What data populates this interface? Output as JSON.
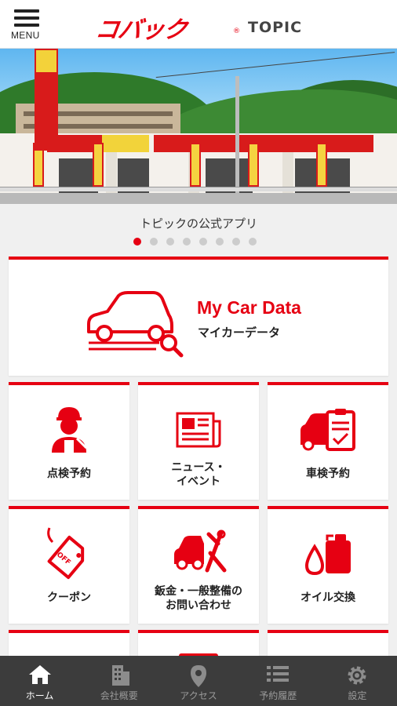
{
  "header": {
    "menu_label": "MENU",
    "logo_text": "コバック",
    "logo_mark": "®",
    "topic_label": "TOPIC"
  },
  "banner": {
    "caption": "トピックの公式アプリ",
    "slide_count": 8,
    "active_slide": 1
  },
  "main": {
    "mycar": {
      "title": "My Car Data",
      "subtitle": "マイカーデータ",
      "icon": "car-search-icon"
    },
    "tiles": [
      {
        "label": "点検予約",
        "icon": "mechanic-icon"
      },
      {
        "label_line1": "ニュース・",
        "label_line2": "イベント",
        "icon": "newspaper-icon"
      },
      {
        "label": "車検予約",
        "icon": "car-checklist-icon"
      },
      {
        "label": "クーポン",
        "icon": "coupon-tag-icon",
        "tag_text": "OFF"
      },
      {
        "label_line1": "鈑金・一般整備の",
        "label_line2": "お問い合わせ",
        "icon": "car-repair-tools-icon"
      },
      {
        "label": "オイル交換",
        "icon": "oil-can-icon"
      }
    ]
  },
  "bottom_nav": {
    "items": [
      {
        "label": "ホーム",
        "icon": "home-icon",
        "active": true
      },
      {
        "label": "会社概要",
        "icon": "building-icon",
        "active": false
      },
      {
        "label": "アクセス",
        "icon": "map-pin-icon",
        "active": false
      },
      {
        "label": "予約履歴",
        "icon": "list-icon",
        "active": false
      },
      {
        "label": "設定",
        "icon": "gear-icon",
        "active": false
      }
    ]
  },
  "colors": {
    "accent": "#e60012",
    "nav_bg": "#3c3c3c",
    "nav_inactive": "#9a9a9a"
  }
}
